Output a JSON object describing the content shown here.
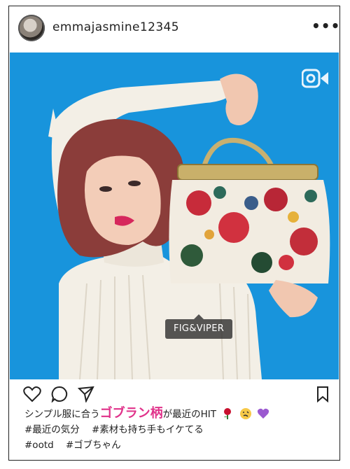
{
  "post": {
    "username": "emmajasmine12345",
    "more_icon": "more-horizontal-icon",
    "media_type_icon": "reel-video-icon",
    "product_tag": "FIG&VIPER"
  },
  "actions": {
    "icons": [
      "heart-icon",
      "comment-icon",
      "share-icon",
      "bookmark-icon"
    ]
  },
  "caption": {
    "line1_pre": "シンプル服に合う",
    "line1_highlight": "ゴブラン柄",
    "line1_post": "が最近のHIT",
    "line1_emojis": [
      "rose-emoji",
      "woozy-face-emoji",
      "purple-heart-emoji"
    ],
    "hashtags_line2": [
      "#最近の気分",
      "#素材も持ち手もイケてる"
    ],
    "hashtags_line3": [
      "#ootd",
      "#ゴブちゃん"
    ]
  },
  "colors": {
    "photo_background": "#1894dc",
    "caption_highlight": "#e0328a",
    "tag_background": "#282828"
  }
}
